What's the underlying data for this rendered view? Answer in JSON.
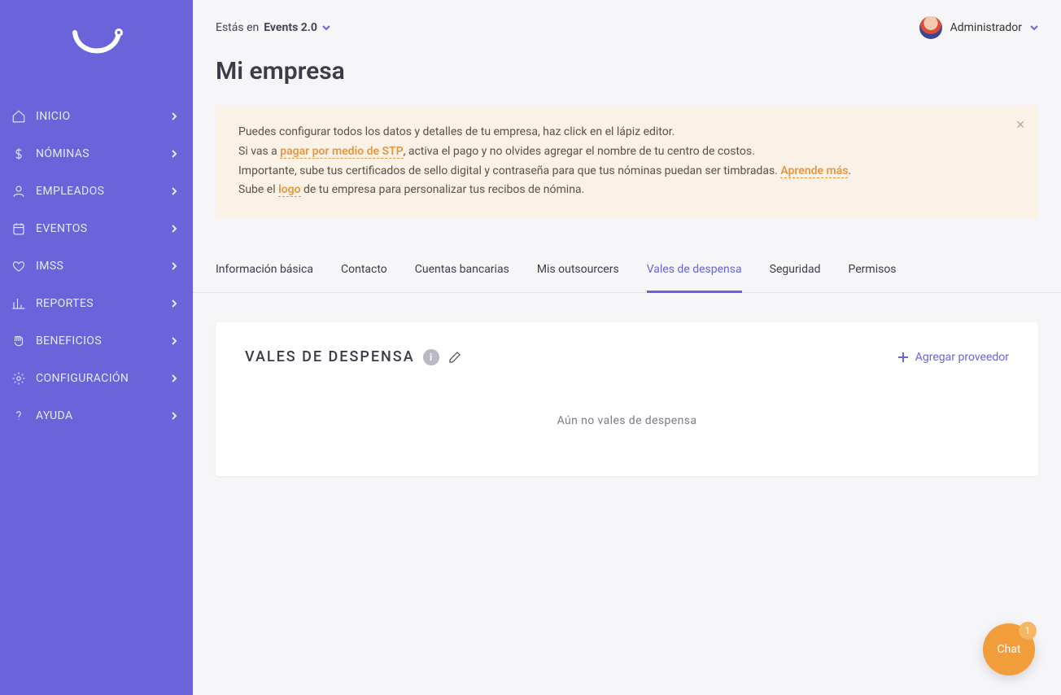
{
  "sidebar": {
    "items": [
      {
        "label": "INICIO",
        "icon": "home"
      },
      {
        "label": "NÓMINAS",
        "icon": "dollar"
      },
      {
        "label": "EMPLEADOS",
        "icon": "user"
      },
      {
        "label": "EVENTOS",
        "icon": "calendar"
      },
      {
        "label": "IMSS",
        "icon": "heart"
      },
      {
        "label": "REPORTES",
        "icon": "bar"
      },
      {
        "label": "BENEFICIOS",
        "icon": "hand"
      },
      {
        "label": "CONFIGURACIÓN",
        "icon": "gear"
      },
      {
        "label": "AYUDA",
        "icon": "help"
      }
    ]
  },
  "header": {
    "workspace_prefix": "Estás en ",
    "workspace_name": "Events 2.0",
    "user_role": "Administrador"
  },
  "page": {
    "title": "Mi empresa"
  },
  "alert": {
    "line1": "Puedes configurar todos los datos y detalles de tu empresa, haz click en el lápiz editor.",
    "line2_pre": "Si vas a ",
    "line2_link": "pagar por medio de STP",
    "line2_post": ", activa el pago y no olvides agregar el nombre de tu centro de costos.",
    "line3_pre": "Importante, sube tus certificados de sello digital y contraseña para que tus nóminas puedan ser timbradas. ",
    "line3_link": "Aprende más",
    "line3_post": ".",
    "line4_pre": "Sube el ",
    "line4_link": "logo",
    "line4_post": " de tu empresa para personalizar tus recibos de nómina."
  },
  "tabs": [
    {
      "label": "Información básica"
    },
    {
      "label": "Contacto"
    },
    {
      "label": "Cuentas bancarias"
    },
    {
      "label": "Mis outsourcers"
    },
    {
      "label": "Vales de despensa",
      "active": true
    },
    {
      "label": "Seguridad"
    },
    {
      "label": "Permisos"
    }
  ],
  "card": {
    "title": "VALES DE DESPENSA",
    "add_label": "Agregar proveedor",
    "empty": "Aún no vales de despensa"
  },
  "chat": {
    "label": "Chat",
    "badge": "1"
  }
}
